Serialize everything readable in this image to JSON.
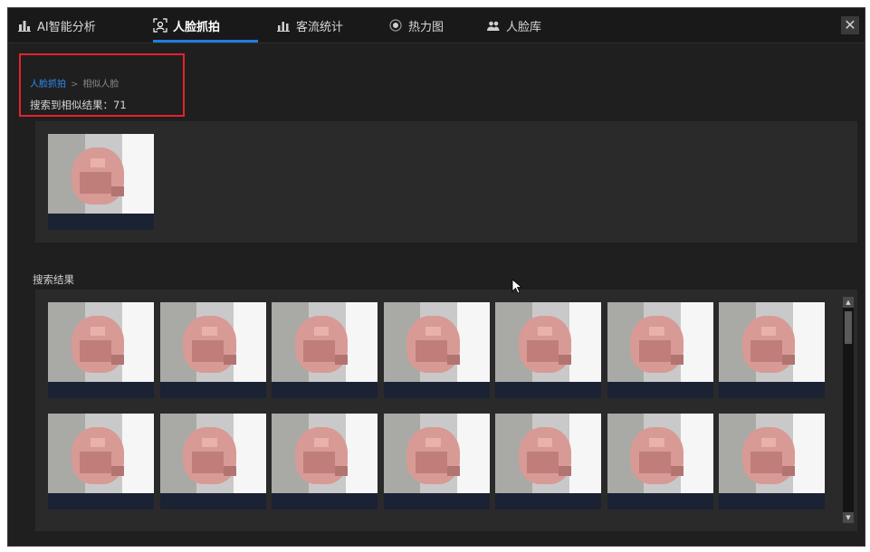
{
  "tabs": [
    {
      "id": "ai-analysis",
      "label": "AI智能分析",
      "icon": "building-chart-icon",
      "active": false
    },
    {
      "id": "face-capture",
      "label": "人脸抓拍",
      "icon": "face-capture-icon",
      "active": true
    },
    {
      "id": "flow-stats",
      "label": "客流统计",
      "icon": "bar-chart-icon",
      "active": false
    },
    {
      "id": "heatmap",
      "label": "热力图",
      "icon": "heatmap-icon",
      "active": false
    },
    {
      "id": "face-library",
      "label": "人脸库",
      "icon": "people-icon",
      "active": false
    }
  ],
  "close_label": "✕",
  "breadcrumb": {
    "parent": "人脸抓拍",
    "separator": ">",
    "current": "相似人脸"
  },
  "result_count_text": "搜索到相似结果：71",
  "query_section": {
    "image": "query-face-thumbnail"
  },
  "results": {
    "title": "搜索结果",
    "item_count_visible": 14
  },
  "colors": {
    "accent": "#1f7de0",
    "highlight_border": "#e3232a",
    "link": "#2d8df5"
  }
}
